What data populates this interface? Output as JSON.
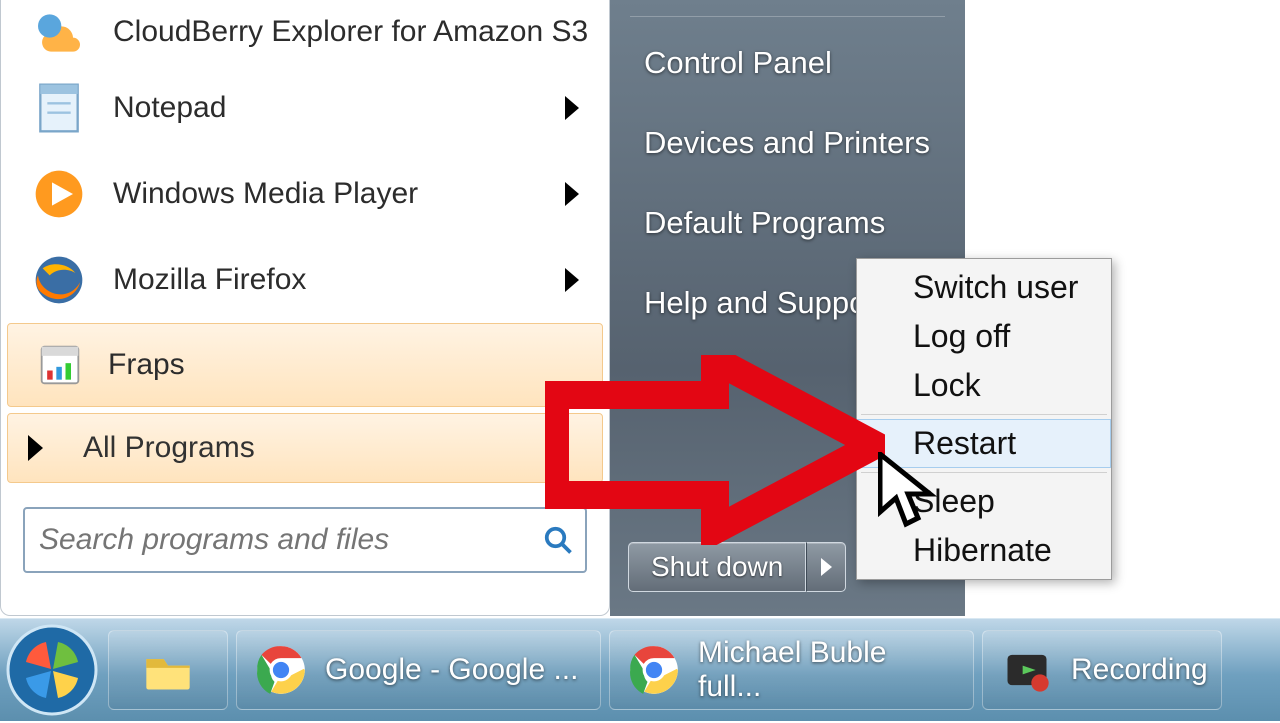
{
  "left": {
    "apps": [
      {
        "label": "CloudBerry Explorer for Amazon S3"
      },
      {
        "label": "Notepad"
      },
      {
        "label": "Windows Media Player"
      },
      {
        "label": "Mozilla Firefox"
      },
      {
        "label": "Fraps"
      }
    ],
    "all_programs": "All Programs",
    "search_placeholder": "Search programs and files"
  },
  "right": {
    "links": [
      "Control Panel",
      "Devices and Printers",
      "Default Programs",
      "Help and Support"
    ],
    "shutdown_label": "Shut down"
  },
  "power_menu": {
    "items_top": [
      "Switch user",
      "Log off",
      "Lock"
    ],
    "restart": "Restart",
    "items_bottom": [
      "Sleep",
      "Hibernate"
    ]
  },
  "taskbar": {
    "items": [
      {
        "label": "Google - Google ..."
      },
      {
        "label": "Michael Buble full..."
      },
      {
        "label": "Recording"
      }
    ]
  }
}
